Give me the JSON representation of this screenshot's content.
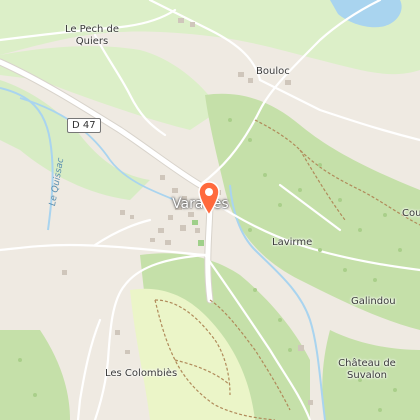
{
  "colors": {
    "background": "#efeae2",
    "meadow": "#dcefc8",
    "forest": "#c5e0a9",
    "park": "#ebf5c8",
    "water": "#a9d4ef",
    "road": "#ffffff",
    "marker": "#ff6a3d"
  },
  "places": {
    "le_pech_de_quiers": "Le Pech de\nQuiers",
    "bouloc": "Bouloc",
    "lavirme": "Lavirme",
    "galindou": "Galindou",
    "cou": "Cou",
    "les_colombies": "Les Colombiès",
    "chateau_de_suvalon": "Château de\nSuvalon"
  },
  "town": {
    "name": "Varaires"
  },
  "road_shield": "D 47",
  "river": "Le Quissac",
  "marker": {
    "icon": "location-pin-icon"
  }
}
